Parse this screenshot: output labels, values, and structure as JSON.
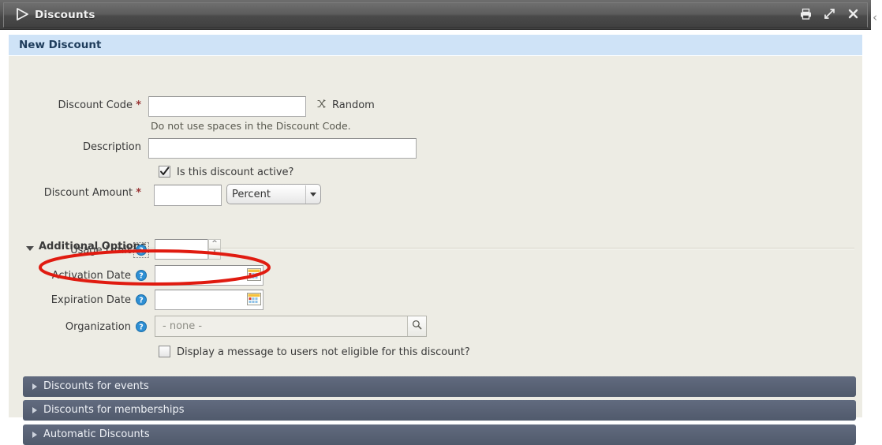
{
  "window": {
    "title": "Discounts",
    "logo_icon": "triangle-play-logo",
    "buttons": [
      {
        "name": "print-button",
        "icon": "printer-icon"
      },
      {
        "name": "maximize-button",
        "icon": "expand-diagonal-icon"
      },
      {
        "name": "close-button",
        "icon": "close-x-icon"
      }
    ],
    "edge_chevron": "‹"
  },
  "section": {
    "title": "New Discount"
  },
  "form": {
    "discount_code": {
      "label": "Discount Code",
      "required_marker": "*",
      "value": "",
      "hint": "Do not use spaces in the Discount Code.",
      "random_label": "Random",
      "random_icon": "shuffle-icon"
    },
    "description": {
      "label": "Description",
      "value": ""
    },
    "active_checkbox": {
      "label": "Is this discount active?",
      "checked": true
    },
    "discount_amount": {
      "label": "Discount Amount",
      "required_marker": "*",
      "value": "",
      "unit_selected": "Percent",
      "unit_options": [
        "Percent",
        "Amount"
      ]
    }
  },
  "additional_options": {
    "label": "Additional Options",
    "expanded": true,
    "usage_limit": {
      "label": "Usage Limit",
      "help_icon": "help-question-icon",
      "value": "",
      "spinner_up": "▲",
      "spinner_down": "▼"
    },
    "activation_date": {
      "label": "Activation Date",
      "help_icon": "help-question-icon",
      "value": "",
      "picker_icon": "calendar-icon"
    },
    "expiration_date": {
      "label": "Expiration Date",
      "help_icon": "help-question-icon",
      "value": "",
      "picker_icon": "calendar-icon"
    },
    "organization": {
      "label": "Organization",
      "help_icon": "help-question-icon",
      "placeholder": "- none -",
      "value": "",
      "search_icon": "magnifier-icon"
    },
    "eligibility_checkbox": {
      "label": "Display a message to users not eligible for this discount?",
      "checked": false
    }
  },
  "collapsed_sections": [
    {
      "label": "Discounts for events"
    },
    {
      "label": "Discounts for memberships"
    },
    {
      "label": "Automatic Discounts"
    }
  ],
  "annotation": {
    "type": "ellipse-highlight",
    "color": "#e01b10",
    "target": "usage-limit-field"
  },
  "colors": {
    "titlebar": "#4a4a4a",
    "section_header": "#cfe3f7",
    "form_background": "#edece4",
    "collapsed_bar": "#596275",
    "required": "#993333",
    "help_blue": "#2e8fd4",
    "annotation_red": "#e01b10"
  }
}
